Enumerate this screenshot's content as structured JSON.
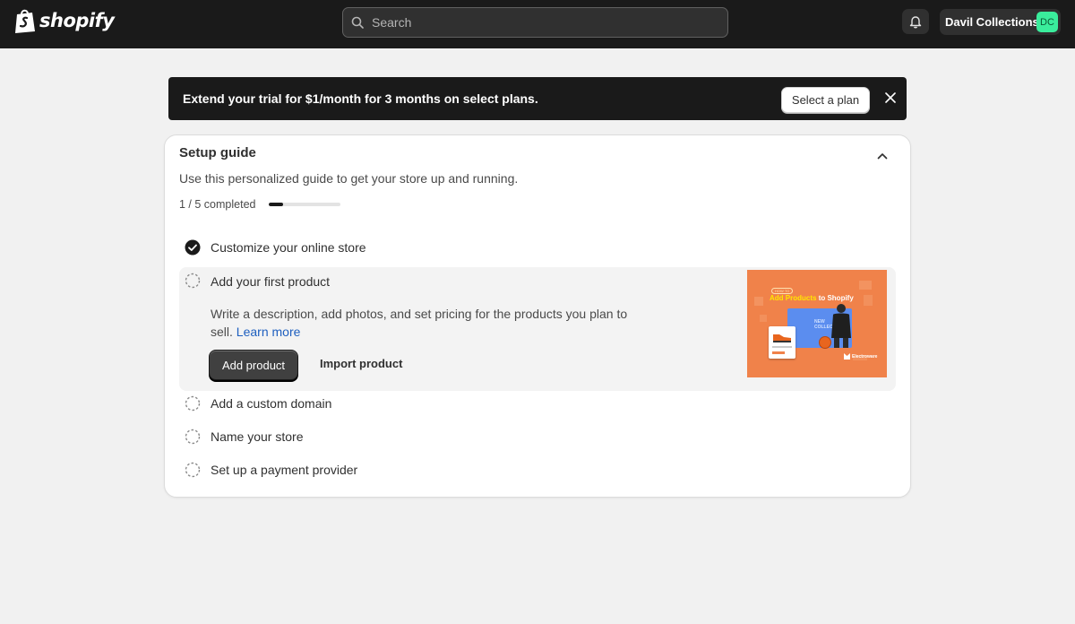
{
  "app": {
    "logo_text": "shopify",
    "search_placeholder": "Search",
    "store_name": "Davil Collections",
    "store_initials": "DC"
  },
  "banner": {
    "text": "Extend your trial for $1/month for 3 months on select plans.",
    "cta_label": "Select a plan"
  },
  "setup_guide": {
    "title": "Setup guide",
    "subtitle": "Use this personalized guide to get your store up and running.",
    "progress_text": "1 / 5 completed",
    "progress_fraction": 0.2,
    "steps": [
      {
        "label": "Customize your online store",
        "completed": true
      },
      {
        "label": "Add your first product",
        "completed": false,
        "expanded": true,
        "description": "Write a description, add photos, and set pricing for the products you plan to sell.",
        "link_label": "Learn more",
        "primary_action": "Add product",
        "secondary_action": "Import product",
        "promo": {
          "tag": "HOW TO",
          "title_highlight": "Add Products",
          "title_rest": "to Shopify",
          "screen_text": "NEW COLLECTION",
          "brand": "Electroware"
        }
      },
      {
        "label": "Add a custom domain",
        "completed": false
      },
      {
        "label": "Name your store",
        "completed": false
      },
      {
        "label": "Set up a payment provider",
        "completed": false
      }
    ]
  },
  "colors": {
    "topbar": "#1a1a1a",
    "page_bg": "#f1f1f1",
    "avatar": "#3aed9c",
    "link": "#1e5fbf",
    "promo_bg": "#f0824a"
  }
}
